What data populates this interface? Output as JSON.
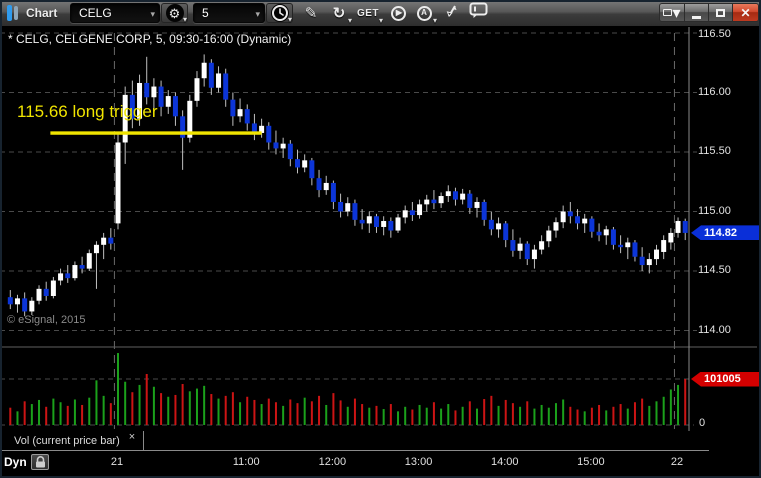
{
  "window": {
    "title": "Chart",
    "controls": [
      "restore-menu",
      "minimize",
      "maximize",
      "close"
    ]
  },
  "toolbar": {
    "symbol_value": "CELG",
    "interval_value": "5",
    "get_label": "GET",
    "icons": [
      "symbol-settings-gear",
      "interval-clock",
      "pencil-draw",
      "refresh-arrow",
      "get-data",
      "play",
      "auto-a",
      "sync-arrows",
      "comment-bubble"
    ]
  },
  "chart": {
    "header": "* CELG, CELGENE CORP, 5, 09:30-16:00 (Dynamic)",
    "watermark": "© eSignal, 2015",
    "annotation": {
      "label": "115.66 long trigger",
      "price": 115.66,
      "color": "#f0e400"
    }
  },
  "price_axis": {
    "ticks": [
      "116.50",
      "116.00",
      "115.50",
      "115.00",
      "114.50",
      "114.00"
    ],
    "last_price": "114.82",
    "last_price_color": "#0a2fd8"
  },
  "volume_axis": {
    "current_volume": "101005",
    "current_color": "#d40000",
    "zero_label": "0"
  },
  "time_axis": {
    "labels": [
      {
        "text": "21",
        "bar": 15
      },
      {
        "text": "11:00",
        "bar": 33
      },
      {
        "text": "12:00",
        "bar": 45
      },
      {
        "text": "13:00",
        "bar": 57
      },
      {
        "text": "14:00",
        "bar": 69
      },
      {
        "text": "15:00",
        "bar": 81
      },
      {
        "text": "22",
        "bar": 93
      }
    ]
  },
  "bottom_bar": {
    "dyn_label": "Dyn",
    "tab_label": "Vol (current price bar)",
    "tab_close": "×"
  },
  "chart_data": {
    "type": "candlestick+volume",
    "symbol": "CELG",
    "company": "CELGENE CORP",
    "interval_minutes": 5,
    "session": "09:30-16:00",
    "price_ylim": [
      113.95,
      116.55
    ],
    "price_gridlines": [
      116.5,
      116.0,
      115.5,
      115.0,
      114.5,
      114.0
    ],
    "volume_gridline": 101005,
    "day_boundary_bars": [
      15,
      93
    ],
    "up_color": "#ffffff",
    "down_color": "#0c35d8",
    "vol_up_color": "#1ba11b",
    "vol_down_color": "#cc1414",
    "wick_color": "#c0c0c0",
    "trigger_line": {
      "price": 115.66,
      "bar_start": 6,
      "bar_end": 35
    },
    "candles": [
      [
        114.28,
        114.34,
        114.18,
        114.22
      ],
      [
        114.22,
        114.3,
        114.15,
        114.27
      ],
      [
        114.27,
        114.32,
        114.12,
        114.16
      ],
      [
        114.16,
        114.28,
        114.13,
        114.25
      ],
      [
        114.25,
        114.38,
        114.22,
        114.35
      ],
      [
        114.35,
        114.41,
        114.25,
        114.29
      ],
      [
        114.29,
        114.45,
        114.27,
        114.42
      ],
      [
        114.42,
        114.52,
        114.38,
        114.48
      ],
      [
        114.48,
        114.55,
        114.4,
        114.44
      ],
      [
        114.44,
        114.58,
        114.42,
        114.55
      ],
      [
        114.55,
        114.62,
        114.48,
        114.52
      ],
      [
        114.52,
        114.68,
        114.5,
        114.65
      ],
      [
        114.65,
        114.75,
        114.35,
        114.72
      ],
      [
        114.72,
        114.82,
        114.6,
        114.78
      ],
      [
        114.78,
        114.86,
        114.68,
        114.73
      ],
      [
        114.9,
        115.65,
        114.85,
        115.58
      ],
      [
        115.58,
        116.05,
        115.4,
        115.98
      ],
      [
        115.98,
        116.1,
        115.7,
        115.78
      ],
      [
        115.78,
        116.15,
        115.72,
        116.08
      ],
      [
        116.08,
        116.3,
        115.9,
        115.96
      ],
      [
        115.96,
        116.12,
        115.85,
        116.05
      ],
      [
        116.05,
        116.1,
        115.8,
        115.88
      ],
      [
        115.88,
        116.02,
        115.82,
        115.97
      ],
      [
        115.97,
        116.0,
        115.72,
        115.8
      ],
      [
        115.8,
        115.85,
        115.35,
        115.62
      ],
      [
        115.62,
        115.98,
        115.58,
        115.93
      ],
      [
        115.93,
        116.18,
        115.88,
        116.12
      ],
      [
        116.12,
        116.32,
        116.05,
        116.25
      ],
      [
        116.25,
        116.28,
        115.98,
        116.04
      ],
      [
        116.04,
        116.22,
        116.0,
        116.16
      ],
      [
        116.16,
        116.2,
        115.88,
        115.94
      ],
      [
        115.94,
        116.0,
        115.72,
        115.8
      ],
      [
        115.8,
        115.95,
        115.75,
        115.86
      ],
      [
        115.86,
        115.9,
        115.68,
        115.74
      ],
      [
        115.74,
        115.82,
        115.6,
        115.66
      ],
      [
        115.66,
        115.78,
        115.62,
        115.72
      ],
      [
        115.72,
        115.75,
        115.52,
        115.58
      ],
      [
        115.58,
        115.68,
        115.48,
        115.53
      ],
      [
        115.53,
        115.62,
        115.45,
        115.57
      ],
      [
        115.57,
        115.6,
        115.38,
        115.44
      ],
      [
        115.44,
        115.52,
        115.32,
        115.37
      ],
      [
        115.37,
        115.48,
        115.33,
        115.43
      ],
      [
        115.43,
        115.45,
        115.22,
        115.28
      ],
      [
        115.28,
        115.35,
        115.12,
        115.18
      ],
      [
        115.18,
        115.3,
        115.14,
        115.24
      ],
      [
        115.24,
        115.26,
        115.02,
        115.08
      ],
      [
        115.08,
        115.15,
        114.95,
        115.0
      ],
      [
        115.0,
        115.12,
        114.96,
        115.07
      ],
      [
        115.07,
        115.1,
        114.88,
        114.93
      ],
      [
        114.93,
        115.02,
        114.85,
        114.9
      ],
      [
        114.9,
        115.0,
        114.82,
        114.96
      ],
      [
        114.96,
        114.98,
        114.82,
        114.87
      ],
      [
        114.87,
        114.96,
        114.8,
        114.92
      ],
      [
        114.92,
        114.95,
        114.78,
        114.84
      ],
      [
        114.84,
        114.98,
        114.82,
        114.95
      ],
      [
        114.95,
        115.05,
        114.9,
        115.01
      ],
      [
        115.01,
        115.08,
        114.92,
        114.97
      ],
      [
        114.97,
        115.1,
        114.94,
        115.06
      ],
      [
        115.06,
        115.14,
        115.0,
        115.1
      ],
      [
        115.1,
        115.18,
        115.02,
        115.07
      ],
      [
        115.07,
        115.16,
        115.03,
        115.13
      ],
      [
        115.13,
        115.22,
        115.08,
        115.17
      ],
      [
        115.17,
        115.2,
        115.05,
        115.1
      ],
      [
        115.1,
        115.19,
        115.06,
        115.15
      ],
      [
        115.15,
        115.18,
        114.98,
        115.03
      ],
      [
        115.03,
        115.12,
        114.95,
        115.08
      ],
      [
        115.08,
        115.1,
        114.88,
        114.93
      ],
      [
        114.93,
        115.0,
        114.8,
        114.85
      ],
      [
        114.85,
        114.95,
        114.78,
        114.9
      ],
      [
        114.9,
        114.92,
        114.7,
        114.76
      ],
      [
        114.76,
        114.85,
        114.62,
        114.67
      ],
      [
        114.67,
        114.78,
        114.6,
        114.73
      ],
      [
        114.73,
        114.75,
        114.55,
        114.6
      ],
      [
        114.6,
        114.72,
        114.52,
        114.68
      ],
      [
        114.68,
        114.8,
        114.64,
        114.75
      ],
      [
        114.75,
        114.88,
        114.7,
        114.84
      ],
      [
        114.84,
        114.95,
        114.78,
        114.91
      ],
      [
        114.91,
        115.05,
        114.86,
        115.0
      ],
      [
        115.0,
        115.08,
        114.9,
        114.96
      ],
      [
        114.96,
        115.02,
        114.85,
        114.9
      ],
      [
        114.9,
        114.98,
        114.82,
        114.94
      ],
      [
        114.94,
        114.96,
        114.78,
        114.83
      ],
      [
        114.83,
        114.9,
        114.75,
        114.8
      ],
      [
        114.8,
        114.88,
        114.72,
        114.85
      ],
      [
        114.85,
        114.87,
        114.68,
        114.72
      ],
      [
        114.72,
        114.8,
        114.65,
        114.7
      ],
      [
        114.7,
        114.78,
        114.6,
        114.74
      ],
      [
        114.74,
        114.76,
        114.58,
        114.62
      ],
      [
        114.62,
        114.7,
        114.5,
        114.55
      ],
      [
        114.55,
        114.65,
        114.48,
        114.6
      ],
      [
        114.6,
        114.72,
        114.55,
        114.68
      ],
      [
        114.66,
        114.8,
        114.6,
        114.76
      ],
      [
        114.74,
        114.86,
        114.68,
        114.82
      ],
      [
        114.82,
        114.95,
        114.78,
        114.92
      ],
      [
        114.92,
        114.94,
        114.76,
        114.82
      ]
    ],
    "volumes": [
      38000,
      30000,
      52000,
      46000,
      55000,
      40000,
      58000,
      50000,
      42000,
      56000,
      44000,
      60000,
      98000,
      64000,
      48000,
      158000,
      95000,
      72000,
      88000,
      112000,
      84000,
      70000,
      62000,
      66000,
      90000,
      74000,
      80000,
      86000,
      68000,
      58000,
      64000,
      72000,
      50000,
      62000,
      55000,
      46000,
      58000,
      50000,
      42000,
      56000,
      48000,
      60000,
      52000,
      64000,
      44000,
      70000,
      54000,
      40000,
      58000,
      46000,
      38000,
      42000,
      35000,
      46000,
      30000,
      40000,
      34000,
      44000,
      38000,
      50000,
      36000,
      46000,
      32000,
      40000,
      52000,
      36000,
      57000,
      64000,
      42000,
      55000,
      48000,
      40000,
      52000,
      36000,
      44000,
      38000,
      48000,
      56000,
      40000,
      34000,
      30000,
      38000,
      44000,
      32000,
      40000,
      46000,
      36000,
      50000,
      58000,
      42000,
      52000,
      62000,
      78000,
      88000,
      101005
    ]
  }
}
